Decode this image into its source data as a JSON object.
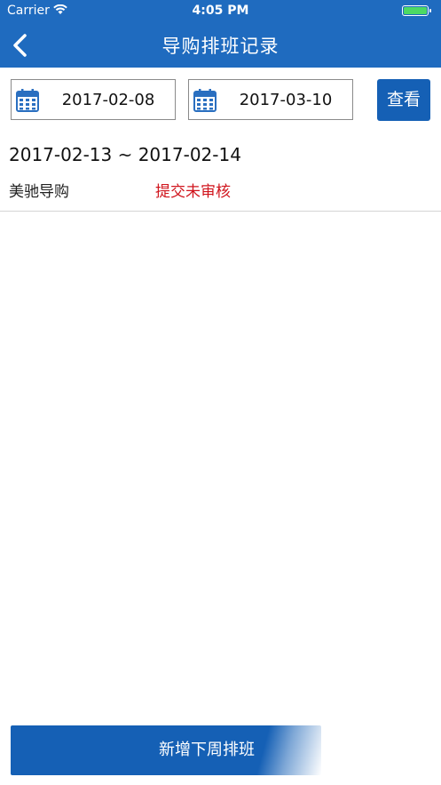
{
  "status_bar": {
    "carrier": "Carrier",
    "time": "4:05 PM"
  },
  "nav": {
    "title": "导购排班记录",
    "back_icon": "chevron-left-icon"
  },
  "filter": {
    "start_date": "2017-02-08",
    "end_date": "2017-03-10",
    "query_label": "查看",
    "calendar_icon": "calendar-icon"
  },
  "records": [
    {
      "range": "2017-02-13 ~ 2017-02-14",
      "brand": "美驰导购",
      "status": "提交未审核"
    }
  ],
  "add_button_label": "新增下周排班",
  "colors": {
    "primary": "#1f6bbf",
    "button": "#1560b5",
    "status_red": "#d0141c"
  }
}
